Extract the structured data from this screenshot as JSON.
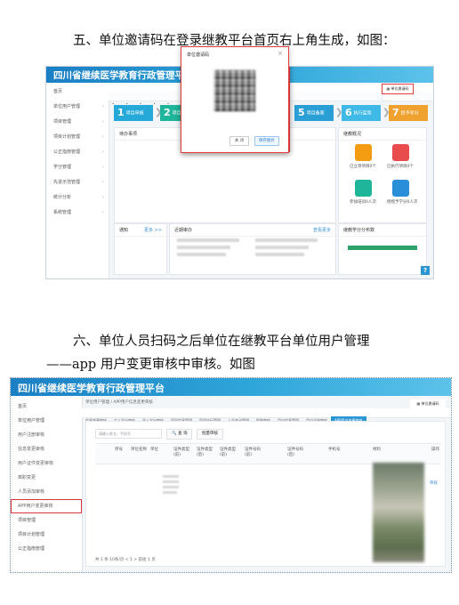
{
  "section5": {
    "heading": "五、单位邀请码在登录继教平台首页右上角生成，如图："
  },
  "section6": {
    "heading_line1": "六、单位人员扫码之后单位在继教平台单位用户管理",
    "heading_line2": "——app 用户变更审核中审核。如图"
  },
  "app": {
    "title": "四川省继续医学教育行政管理平台",
    "qr_button": "单位邀请码",
    "home_label": "首页"
  },
  "shot1": {
    "sidebar": [
      "首页",
      "单位用户管理",
      "项目管理",
      "项目计划管理",
      "公正指南管理",
      "学分管理",
      "先进示范管理",
      "统计分析",
      "系统管理"
    ],
    "steps": [
      {
        "num": "1",
        "label": "项目申报",
        "color": "#24a9d8"
      },
      {
        "num": "2",
        "label": "项目审核",
        "color": "#1fb59a"
      },
      {
        "num": "5",
        "label": "项目备案",
        "color": "#2a9fd6"
      },
      {
        "num": "6",
        "label": "执行监管",
        "color": "#3fb9e6"
      },
      {
        "num": "7",
        "label": "授予学分",
        "color": "#f0a22f"
      }
    ],
    "todo_title": "待办事项",
    "overview_title": "继教概况",
    "overview_items": [
      {
        "label": "已立项项目0个",
        "color": "#f39c12"
      },
      {
        "label": "已执行项目0个",
        "color": "#e84c4c"
      },
      {
        "label": "参加培训0人次",
        "color": "#1fb59a"
      },
      {
        "label": "授授予学分0人次",
        "color": "#2a8fd8"
      }
    ],
    "notice_title": "通知",
    "notice_more": "更多 >>",
    "approval_title": "近期审办",
    "approval_more": "查看更多",
    "credit_title": "继教学分分布数",
    "modal": {
      "title": "单位邀请码",
      "close": "×",
      "btn_close": "关 闭",
      "btn_save": "保存图片"
    }
  },
  "shot2": {
    "sidebar": [
      "首页",
      "单位用户管理",
      "用户注册审核",
      "信息变更审核",
      "用户证件变更审核",
      "离职变更",
      "人员添加审核",
      "APP用户变更审核",
      "项目管理",
      "项目计划管理",
      "公正指南管理"
    ],
    "breadcrumb": "单位用户管理 / APP用户信息变更审核",
    "tabs": [
      "信息变更审核",
      "个人学分审核",
      "录入学分审核",
      "项目信息管理",
      "项目执行管理",
      "人员变动管理",
      "职称审核",
      "用户信息管理",
      "用户注册审核",
      "APP用户变更审核"
    ],
    "search_placeholder": "请输入姓名、手机号",
    "btn_query": "查 询",
    "btn_export": "批量审核",
    "columns": [
      "序号",
      "单位名称",
      "单位",
      "证件类型(前)",
      "证件类型(后)",
      "证件类型(前)",
      "证件号码(前)",
      "证件号码(后)",
      "手机号",
      "材料",
      "操作"
    ],
    "row_action": "审核",
    "pager": "共 1 条    10条/页    <    1    >    前往    1    页"
  }
}
